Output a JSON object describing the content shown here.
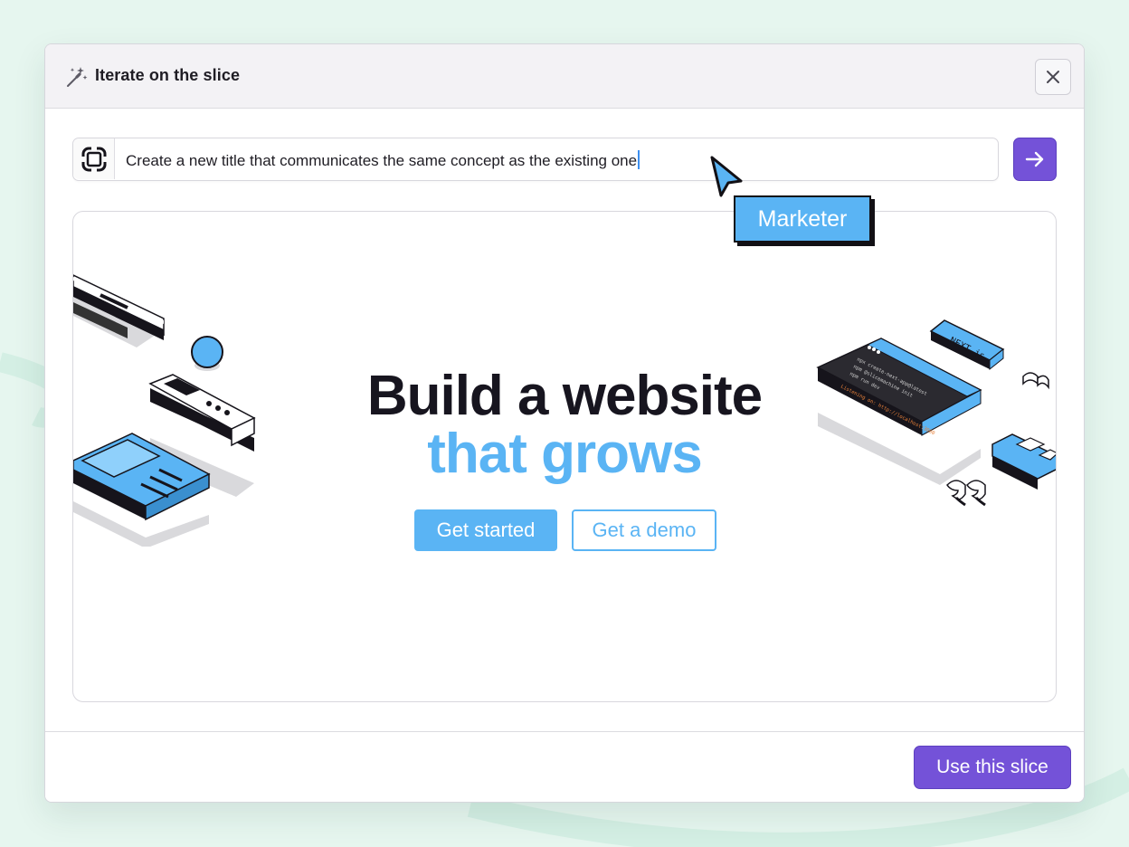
{
  "colors": {
    "accent": "#7452d8",
    "hero_blue": "#5ab4f4",
    "background": "#e6f6ef",
    "dark_text": "#17151f"
  },
  "modal": {
    "title": "Iterate on the slice",
    "title_icon": "magic-wand-icon",
    "close_icon": "close-icon"
  },
  "prompt": {
    "logo_icon": "prismic-logo-icon",
    "value": "Create a new title that communicates the same concept as the existing one",
    "submit_icon": "arrow-right-icon"
  },
  "preview": {
    "headline_line1": "Build a website",
    "headline_line2": "that grows",
    "primary_cta": "Get started",
    "secondary_cta": "Get a demo",
    "terminal_lines": [
      "npx create-next-app@latest",
      "npm @slicemachine init",
      "npm run dev",
      "Listening on: http://localhost:3000"
    ],
    "badge_text": "NEXT.js"
  },
  "footer": {
    "use_slice_label": "Use this slice"
  },
  "persona": {
    "label": "Marketer",
    "cursor_icon": "mouse-pointer-icon"
  }
}
